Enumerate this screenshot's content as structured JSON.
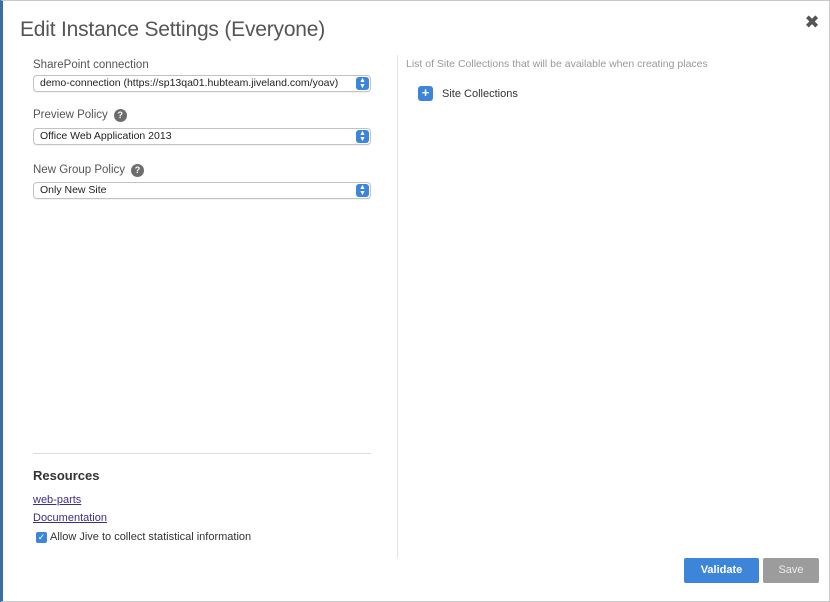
{
  "dialog": {
    "title": "Edit Instance Settings (Everyone)",
    "close_icon": "close-icon"
  },
  "form": {
    "sharepoint_connection": {
      "label": "SharePoint connection",
      "value": "demo-connection (https://sp13qa01.hubteam.jiveland.com/yoav)"
    },
    "preview_policy": {
      "label": "Preview Policy",
      "value": "Office Web Application 2013"
    },
    "new_group_policy": {
      "label": "New Group Policy",
      "value": "Only New Site"
    },
    "help_glyph": "?"
  },
  "resources": {
    "title": "Resources",
    "links": [
      "web-parts",
      "Documentation"
    ],
    "checkbox_label": "Allow Jive to collect statistical information",
    "checkbox_checked": true
  },
  "site_collections": {
    "caption": "List of Site Collections that will be available when creating places",
    "label": "Site Collections"
  },
  "buttons": {
    "validate": "Validate",
    "save": "Save"
  },
  "colors": {
    "accent": "#3c85d8",
    "disabled_button": "#9c9c9c"
  }
}
